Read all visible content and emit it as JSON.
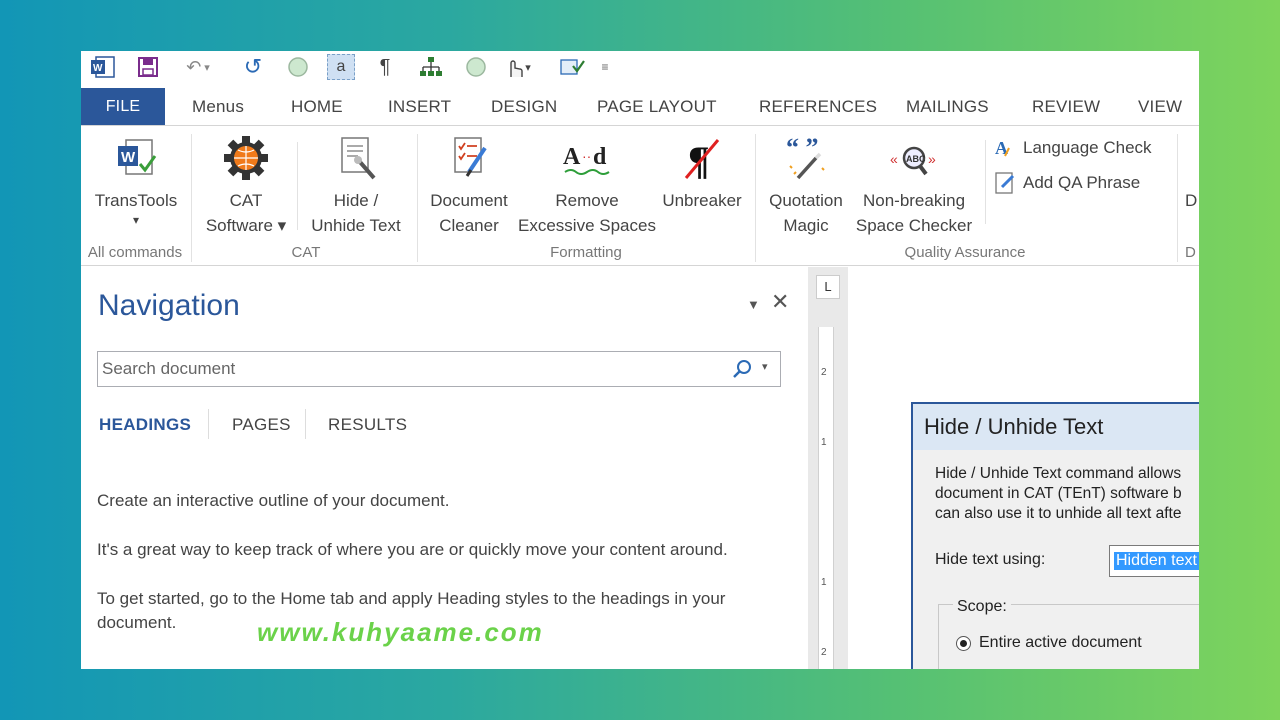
{
  "quick_access": {
    "icons": [
      "word-icon",
      "save-icon",
      "undo-icon",
      "redo-icon",
      "circle-icon",
      "a-icon",
      "pilcrow-icon",
      "tree-icon",
      "circle-icon",
      "touch-icon",
      "check-icon",
      "customize-icon"
    ]
  },
  "tabs": [
    "FILE",
    "Menus",
    "HOME",
    "INSERT",
    "DESIGN",
    "PAGE LAYOUT",
    "REFERENCES",
    "MAILINGS",
    "REVIEW",
    "VIEW"
  ],
  "ribbon": {
    "transtools": {
      "label": "TransTools",
      "dropdown": "▾"
    },
    "all_commands": "All commands",
    "cat_software": {
      "line1": "CAT",
      "line2": "Software ▾"
    },
    "hide_unhide": {
      "line1": "Hide /",
      "line2": "Unhide Text"
    },
    "cat_group": "CAT",
    "document_cleaner": {
      "line1": "Document",
      "line2": "Cleaner"
    },
    "remove_spaces": {
      "line1": "Remove",
      "line2": "Excessive Spaces"
    },
    "unbreaker": "Unbreaker",
    "formatting_group": "Formatting",
    "quotation_magic": {
      "line1": "Quotation",
      "line2": "Magic"
    },
    "nbsp_checker": {
      "line1": "Non-breaking",
      "line2": "Space Checker"
    },
    "language_check": "Language Check",
    "add_qa_phrase": "Add QA Phrase",
    "qa_group": "Quality Assurance",
    "cut_letter": "D",
    "cut_letter_2": "D"
  },
  "navigation": {
    "title": "Navigation",
    "search_placeholder": "Search document",
    "tabs": [
      "HEADINGS",
      "PAGES",
      "RESULTS"
    ],
    "para1": "Create an interactive outline of your document.",
    "para2": "It's a great way to keep track of where you are or quickly move your content around.",
    "para3": "To get started, go to the Home tab and apply Heading styles to the headings in your document."
  },
  "ruler_marks": [
    "2",
    "1",
    "1",
    "2"
  ],
  "dialog": {
    "title": "Hide / Unhide Text",
    "desc1": "Hide / Unhide Text command allows",
    "desc2": "document in CAT (TEnT) software b",
    "desc3": "can also use it to unhide all text afte",
    "hide_using_label": "Hide text using:",
    "hide_using_value": "Hidden text",
    "scope_label": "Scope:",
    "scope_option": "Entire active document"
  },
  "watermark": "www.kuhyaame.com",
  "colors": {
    "accent": "#2b579a",
    "watermark": "#6bd24a"
  }
}
